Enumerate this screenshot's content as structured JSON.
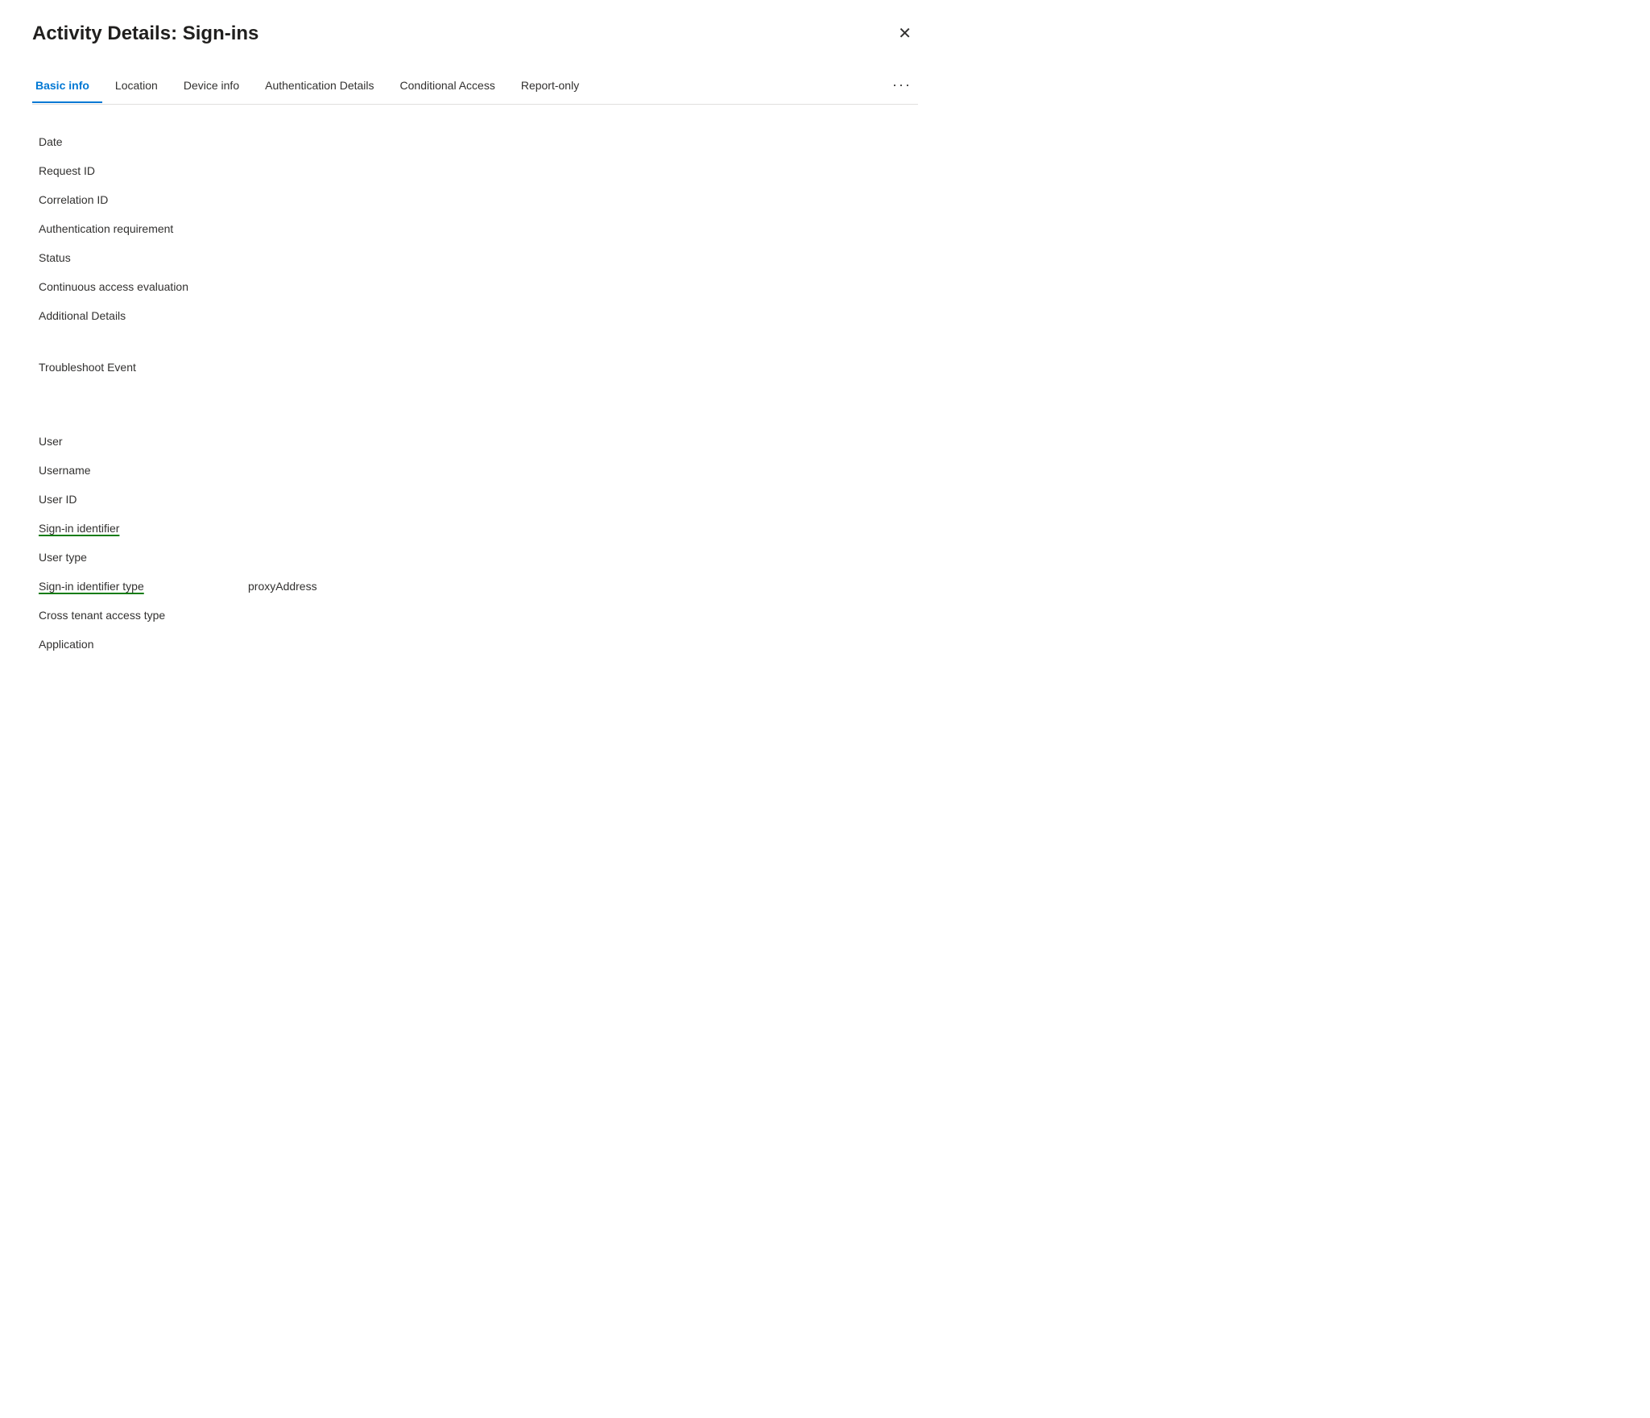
{
  "dialog": {
    "title": "Activity Details: Sign-ins",
    "close_label": "✕"
  },
  "tabs": [
    {
      "id": "basic-info",
      "label": "Basic info",
      "active": true
    },
    {
      "id": "location",
      "label": "Location",
      "active": false
    },
    {
      "id": "device-info",
      "label": "Device info",
      "active": false
    },
    {
      "id": "authentication-details",
      "label": "Authentication Details",
      "active": false
    },
    {
      "id": "conditional-access",
      "label": "Conditional Access",
      "active": false
    },
    {
      "id": "report-only",
      "label": "Report-only",
      "active": false
    }
  ],
  "tab_more_label": "···",
  "fields": [
    {
      "id": "date",
      "label": "Date",
      "value": "",
      "underlined": false
    },
    {
      "id": "request-id",
      "label": "Request ID",
      "value": "",
      "underlined": false
    },
    {
      "id": "correlation-id",
      "label": "Correlation ID",
      "value": "",
      "underlined": false
    },
    {
      "id": "auth-requirement",
      "label": "Authentication requirement",
      "value": "",
      "underlined": false
    },
    {
      "id": "status",
      "label": "Status",
      "value": "",
      "underlined": false
    },
    {
      "id": "continuous-access",
      "label": "Continuous access evaluation",
      "value": "",
      "underlined": false
    },
    {
      "id": "additional-details",
      "label": "Additional Details",
      "value": "",
      "underlined": false
    }
  ],
  "troubleshoot": {
    "label": "Troubleshoot Event",
    "value": ""
  },
  "user_fields": [
    {
      "id": "user",
      "label": "User",
      "value": "",
      "underlined": false
    },
    {
      "id": "username",
      "label": "Username",
      "value": "",
      "underlined": false
    },
    {
      "id": "user-id",
      "label": "User ID",
      "value": "",
      "underlined": false
    },
    {
      "id": "sign-in-identifier",
      "label": "Sign-in identifier",
      "value": "",
      "underlined": true
    },
    {
      "id": "user-type",
      "label": "User type",
      "value": "",
      "underlined": false
    },
    {
      "id": "sign-in-identifier-type",
      "label": "Sign-in identifier type",
      "value": "proxyAddress",
      "underlined": true
    },
    {
      "id": "cross-tenant-access-type",
      "label": "Cross tenant access type",
      "value": "",
      "underlined": false
    },
    {
      "id": "application",
      "label": "Application",
      "value": "",
      "underlined": false
    }
  ]
}
